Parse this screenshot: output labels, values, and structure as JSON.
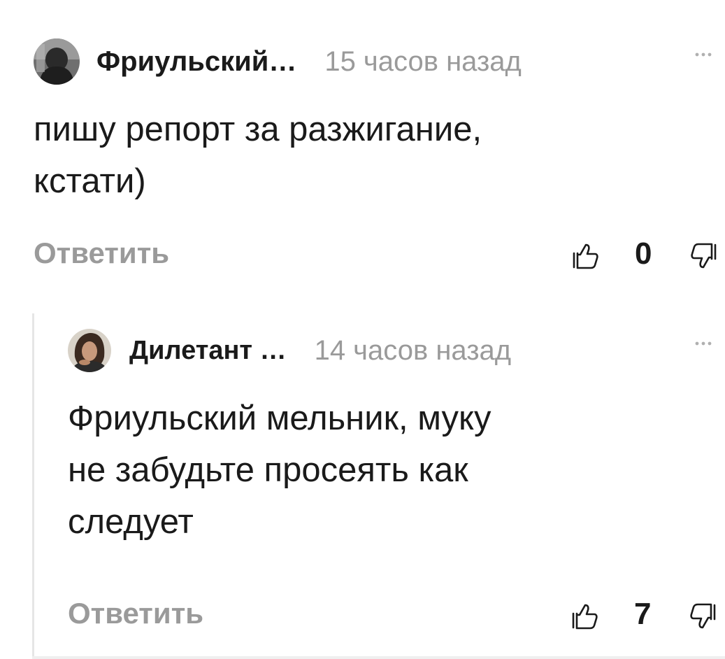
{
  "comments": [
    {
      "author": "Фриульский…",
      "time": "15 часов назад",
      "text_lines": [
        "пишу репорт за разжигание,",
        "кстати)"
      ],
      "reply_label": "Ответить",
      "rating": "0",
      "avatar_icon": "user-avatar-dark",
      "more_icon": "ellipsis-icon"
    },
    {
      "author": "Дилетант …",
      "time": "14 часов назад",
      "text_lines": [
        "Фриульский мельник, муку",
        "не забудьте просеять как",
        "следует"
      ],
      "reply_label": "Ответить",
      "rating": "7",
      "avatar_icon": "user-avatar-portrait",
      "more_icon": "ellipsis-icon"
    }
  ],
  "colors": {
    "text": "#1a1a1a",
    "muted": "#9a9a9a",
    "thread_line": "#e6e6e6"
  }
}
